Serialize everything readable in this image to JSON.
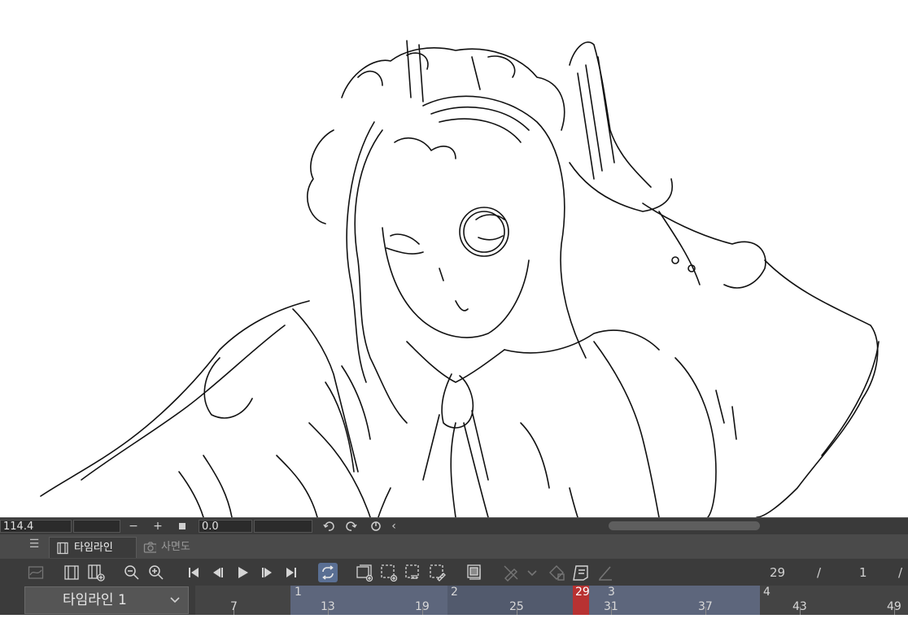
{
  "status": {
    "zoom": "114.4",
    "minus": "−",
    "plus": "+",
    "angle": "0.0",
    "scroll_left": "‹"
  },
  "panel": {
    "tabs": [
      {
        "label": "타임라인",
        "active": true
      },
      {
        "label": "사면도",
        "active": false
      }
    ]
  },
  "toolbar": {
    "current_frame": "29",
    "separator": "/",
    "start_frame": "1",
    "separator2": "/"
  },
  "track": {
    "timeline_name": "타임라인 1",
    "cels": [
      "1",
      "2",
      "29",
      "3",
      "4"
    ],
    "frame_numbers": [
      "7",
      "13",
      "19",
      "25",
      "31",
      "37",
      "43",
      "49"
    ],
    "current_frame": "29"
  },
  "colors": {
    "accent": "#5a6f93",
    "playhead": "#b83232",
    "cel_band": "#5d667c"
  }
}
